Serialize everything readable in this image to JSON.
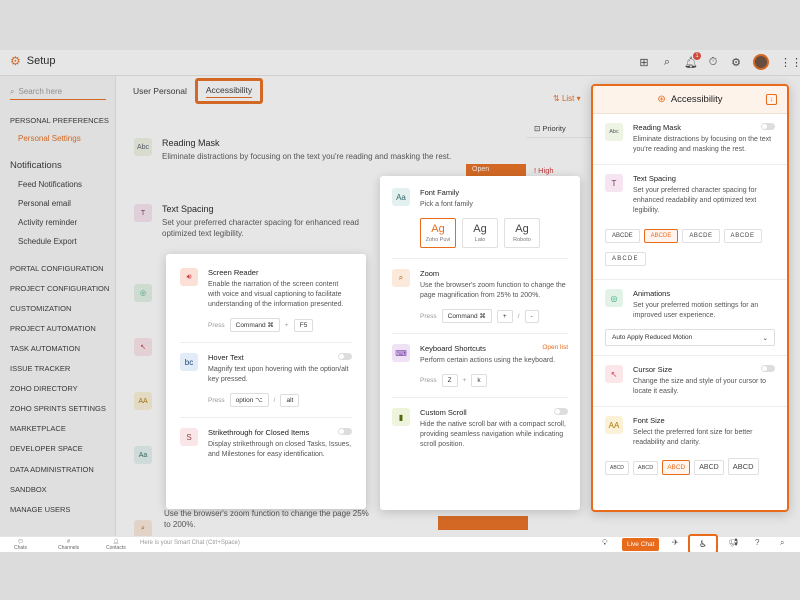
{
  "header": {
    "title": "Setup",
    "notification_count": "1"
  },
  "sidebar": {
    "search_placeholder": "Search here",
    "sections": [
      {
        "label": "PERSONAL PREFERENCES"
      },
      {
        "label": "Personal Settings",
        "active": true
      },
      {
        "label": "Notifications"
      },
      {
        "label": "Feed Notifications"
      },
      {
        "label": "Personal email"
      },
      {
        "label": "Activity reminder"
      },
      {
        "label": "Schedule Export"
      },
      {
        "label": "PORTAL CONFIGURATION"
      },
      {
        "label": "PROJECT CONFIGURATION"
      },
      {
        "label": "CUSTOMIZATION"
      },
      {
        "label": "PROJECT AUTOMATION"
      },
      {
        "label": "TASK AUTOMATION"
      },
      {
        "label": "ISSUE TRACKER"
      },
      {
        "label": "ZOHO DIRECTORY"
      },
      {
        "label": "ZOHO SPRINTS SETTINGS"
      },
      {
        "label": "MARKETPLACE"
      },
      {
        "label": "DEVELOPER SPACE"
      },
      {
        "label": "DATA ADMINISTRATION"
      },
      {
        "label": "SANDBOX"
      },
      {
        "label": "MANAGE USERS"
      }
    ]
  },
  "tabs": {
    "user_personal": "User Personal",
    "accessibility": "Accessibility"
  },
  "background": {
    "list_label": "List",
    "priority_label": "Priority",
    "open_label": "Open",
    "high_label": "High",
    "reading_mask": {
      "title": "Reading Mask",
      "desc": "Eliminate distractions by focusing on the text you're reading and masking the rest."
    },
    "text_spacing": {
      "title": "Text Spacing",
      "desc": "Set your preferred character spacing for enhanced read optimized text legibility."
    },
    "zoom_desc": "Use the browser's zoom function to change the page 25% to 200%."
  },
  "card_left": {
    "screen_reader": {
      "title": "Screen Reader",
      "desc": "Enable the narration of the screen content with voice and visual captioning to facilitate understanding of the information presented.",
      "press": "Press",
      "key1": "Command ⌘",
      "plus": "+",
      "key2": "F5"
    },
    "hover_text": {
      "title": "Hover Text",
      "desc": "Magnify text upon hovering with the option/alt key pressed.",
      "press": "Press",
      "key1": "option ⌥",
      "slash": "/",
      "key2": "alt"
    },
    "strikethrough": {
      "title": "Strikethrough for Closed Items",
      "desc": "Display strikethrough on closed Tasks, Issues, and Milestones for easy identification."
    }
  },
  "card_mid": {
    "font_family": {
      "title": "Font Family",
      "desc": "Pick a font family",
      "fonts": [
        {
          "ag": "Ag",
          "name": "Zoho Puvi"
        },
        {
          "ag": "Ag",
          "name": "Lato"
        },
        {
          "ag": "Ag",
          "name": "Roboto"
        }
      ]
    },
    "zoom": {
      "title": "Zoom",
      "desc": "Use the browser's zoom function to change the page magnification from 25% to 200%.",
      "press": "Press",
      "key1": "Command ⌘",
      "plus": "+",
      "slash": "/",
      "minus": "-"
    },
    "shortcuts": {
      "title": "Keyboard Shortcuts",
      "link": "Open list",
      "desc": "Perform certain actions using the keyboard.",
      "press": "Press",
      "key1": "Z",
      "plus": "+",
      "key2": "k"
    },
    "custom_scroll": {
      "title": "Custom Scroll",
      "desc": "Hide the native scroll bar with a compact scroll, providing seamless navigation while indicating scroll position."
    }
  },
  "panel": {
    "title": "Accessibility",
    "reading_mask": {
      "title": "Reading Mask",
      "desc": "Eliminate distractions by focusing on the text you're reading and masking the rest."
    },
    "text_spacing": {
      "title": "Text Spacing",
      "desc": "Set your preferred character spacing for enhanced readability and optimized text legibility.",
      "options": [
        "ABCDE",
        "ABCDE",
        "ABCDE",
        "ABCDE",
        "ABCDE"
      ],
      "selected_index": 1
    },
    "animations": {
      "title": "Animations",
      "desc": "Set your preferred motion settings for an improved user experience.",
      "value": "Auto Apply Reduced Motion"
    },
    "cursor_size": {
      "title": "Cursor Size",
      "desc": "Change the size and style of your cursor to locate it easily."
    },
    "font_size": {
      "title": "Font Size",
      "desc": "Select the preferred font size for better readability and clarity.",
      "options": [
        "ABCD",
        "ABCD",
        "ABCD",
        "ABCD",
        "ABCD"
      ],
      "selected_index": 2
    }
  },
  "bottombar": {
    "chats": "Chats",
    "channels": "Channels",
    "contacts": "Contacts",
    "smart_chat": "Here is your Smart Chat (Ctrl+Space)",
    "live_chat": "Live Chat"
  },
  "colors": {
    "accent": "#e86b1c"
  }
}
